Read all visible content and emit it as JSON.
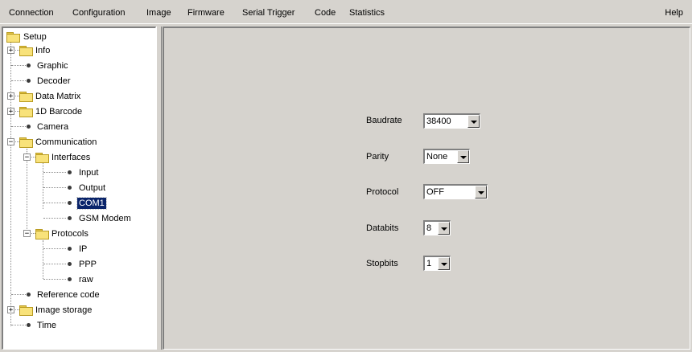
{
  "menu": {
    "items": [
      "Connection",
      "Configuration",
      "Image",
      "Firmware",
      "Serial Trigger",
      "Code",
      "Statistics"
    ],
    "help": "Help"
  },
  "tree": {
    "nodes": [
      {
        "label": "Setup",
        "type": "folder",
        "expander": ""
      },
      {
        "label": "Info",
        "type": "folder",
        "expander": "+"
      },
      {
        "label": "Graphic",
        "type": "leaf"
      },
      {
        "label": "Decoder",
        "type": "leaf"
      },
      {
        "label": "Data Matrix",
        "type": "folder",
        "expander": "+"
      },
      {
        "label": "1D Barcode",
        "type": "folder",
        "expander": "+"
      },
      {
        "label": "Camera",
        "type": "leaf"
      },
      {
        "label": "Communication",
        "type": "folder",
        "expander": "−"
      },
      {
        "label": "Interfaces",
        "type": "folder",
        "expander": "−"
      },
      {
        "label": "Input",
        "type": "leaf"
      },
      {
        "label": "Output",
        "type": "leaf"
      },
      {
        "label": "COM1",
        "type": "leaf",
        "selected": true
      },
      {
        "label": "GSM Modem",
        "type": "leaf"
      },
      {
        "label": "Protocols",
        "type": "folder",
        "expander": "−"
      },
      {
        "label": "IP",
        "type": "leaf"
      },
      {
        "label": "PPP",
        "type": "leaf"
      },
      {
        "label": "raw",
        "type": "leaf"
      },
      {
        "label": "Reference code",
        "type": "leaf"
      },
      {
        "label": "Image storage",
        "type": "folder",
        "expander": "+"
      },
      {
        "label": "Time",
        "type": "leaf"
      }
    ]
  },
  "form": {
    "baudrate": {
      "label": "Baudrate",
      "value": "38400"
    },
    "parity": {
      "label": "Parity",
      "value": "None"
    },
    "protocol": {
      "label": "Protocol",
      "value": "OFF"
    },
    "databits": {
      "label": "Databits",
      "value": "8"
    },
    "stopbits": {
      "label": "Stopbits",
      "value": "1"
    }
  },
  "colors": {
    "background": "#d6d3ce",
    "selection": "#0a246a",
    "folder": "#f8e27a"
  },
  "icons": {
    "tree_folder": "folder-icon",
    "tree_leaf": "bullet-icon",
    "combo_arrow": "chevron-down-icon"
  }
}
